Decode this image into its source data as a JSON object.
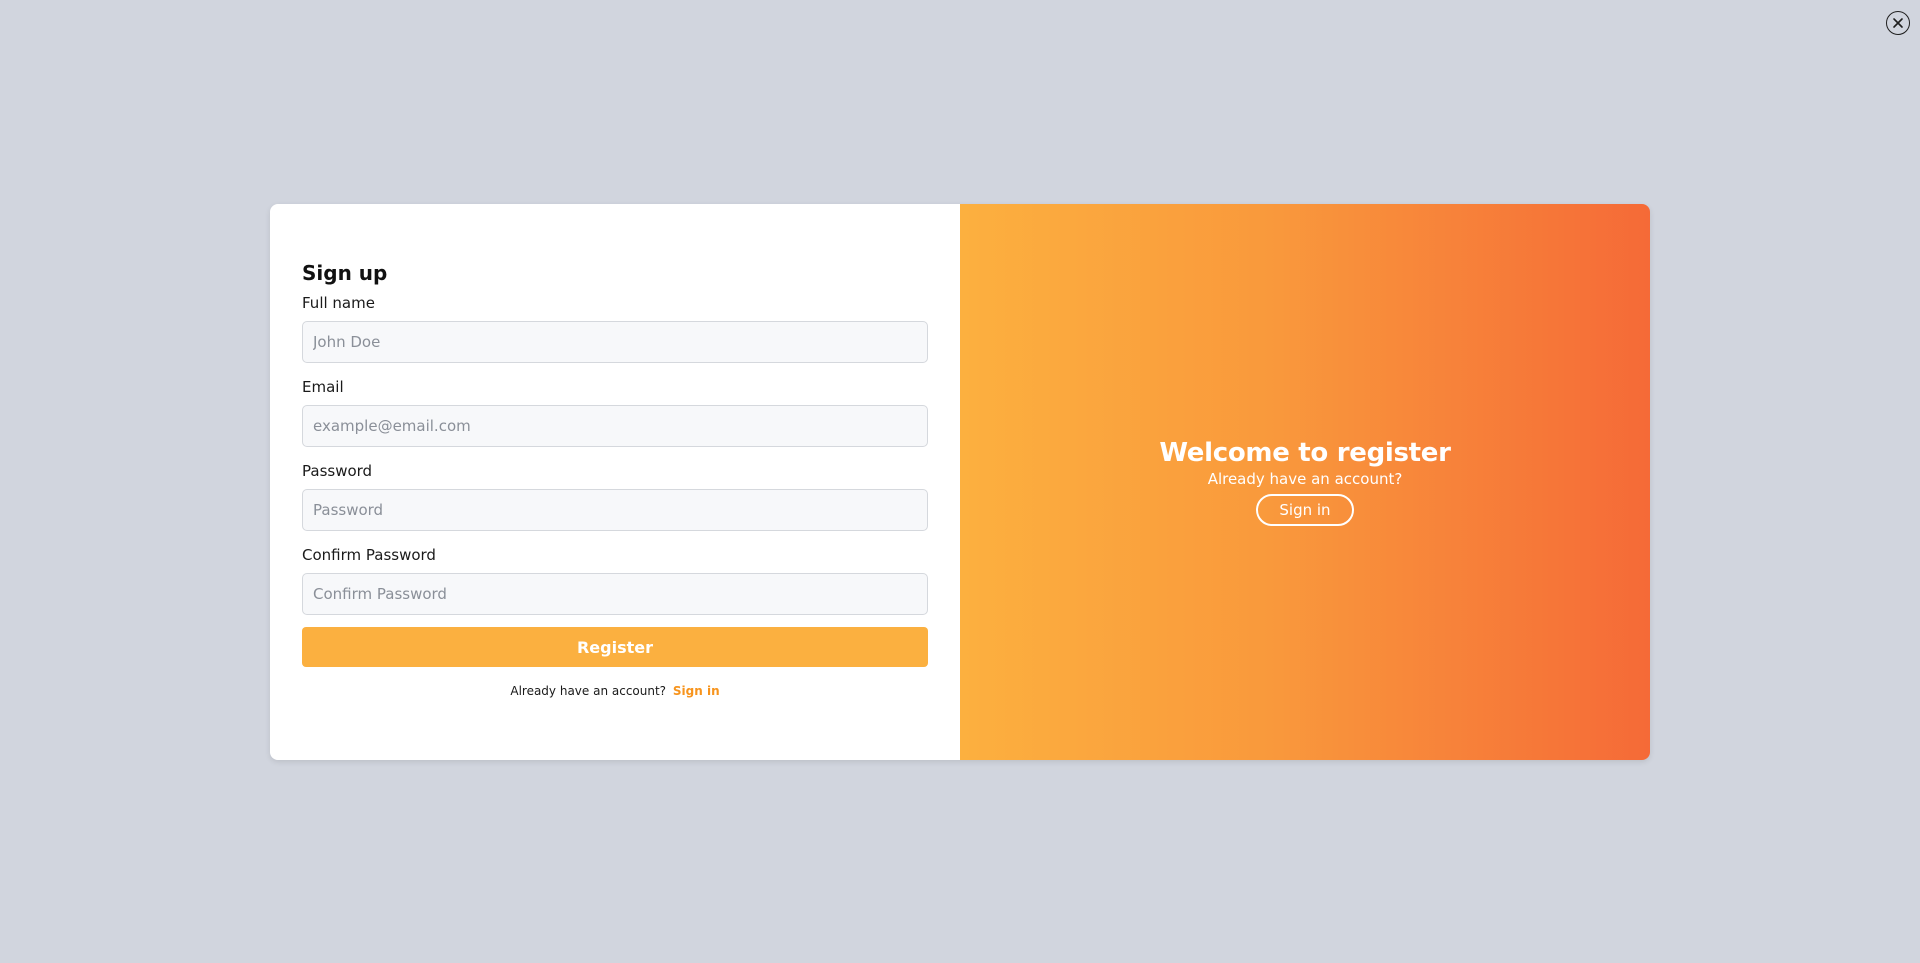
{
  "close": {
    "icon": "close-icon"
  },
  "form": {
    "title": "Sign up",
    "fields": [
      {
        "label": "Full name",
        "placeholder": "John Doe",
        "value": ""
      },
      {
        "label": "Email",
        "placeholder": "example@email.com",
        "value": ""
      },
      {
        "label": "Password",
        "placeholder": "Password",
        "value": ""
      },
      {
        "label": "Confirm Password",
        "placeholder": "Confirm Password",
        "value": ""
      }
    ],
    "submit_label": "Register",
    "signin_prompt": "Already have an account?",
    "signin_link": "Sign in"
  },
  "promo": {
    "title": "Welcome to register",
    "subtitle": "Already have an account?",
    "button_label": "Sign in"
  },
  "colors": {
    "background": "#d1d5de",
    "accent": "#fbb040",
    "link": "#f7941d",
    "gradient_start": "#fcb03f",
    "gradient_end": "#f56a37"
  }
}
